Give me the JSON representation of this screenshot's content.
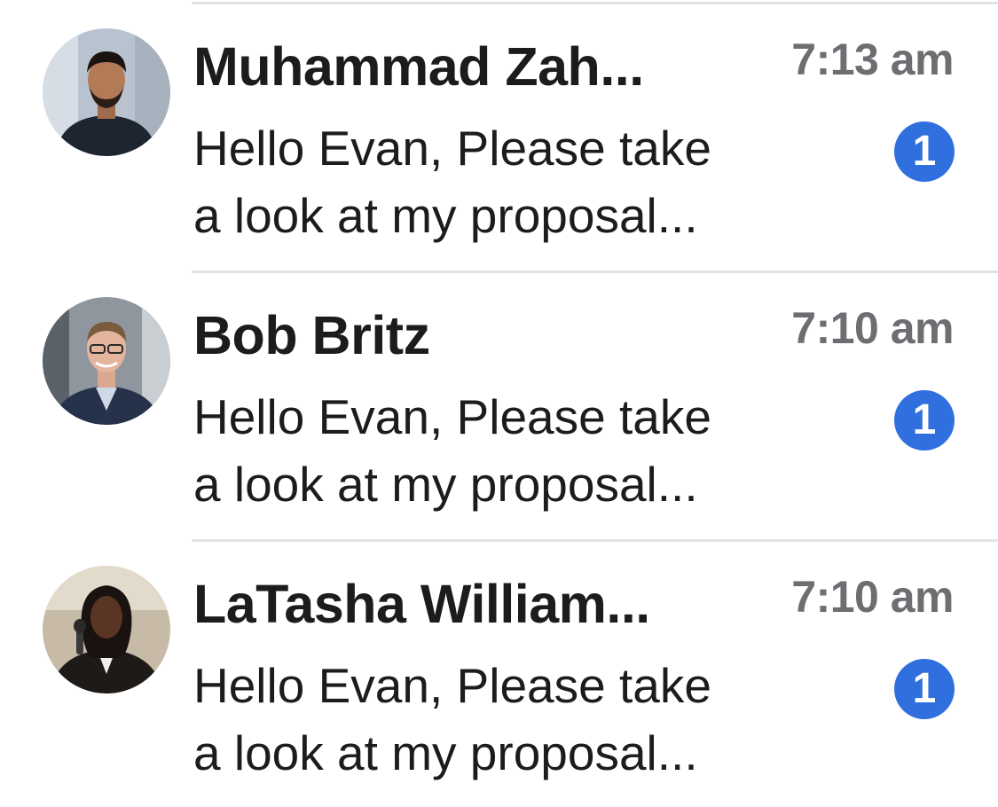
{
  "conversations": [
    {
      "name": "Muhammad Zah...",
      "time": "7:13 am",
      "preview_line1": "Hello Evan, Please take",
      "preview_line2": "a look at my proposal...",
      "unread_count": "1",
      "avatar_icon": "person-photo-avatar"
    },
    {
      "name": "Bob Britz",
      "time": "7:10 am",
      "preview_line1": "Hello Evan, Please take",
      "preview_line2": "a look at my proposal...",
      "unread_count": "1",
      "avatar_icon": "person-photo-avatar"
    },
    {
      "name": "LaTasha William...",
      "time": "7:10 am",
      "preview_line1": "Hello Evan, Please take",
      "preview_line2": "a look at my proposal...",
      "unread_count": "1",
      "avatar_icon": "person-photo-avatar"
    }
  ],
  "colors": {
    "badge": "#2f6fde",
    "time": "#6d6d72",
    "divider": "#e3e3e6",
    "text": "#1c1c1e"
  }
}
